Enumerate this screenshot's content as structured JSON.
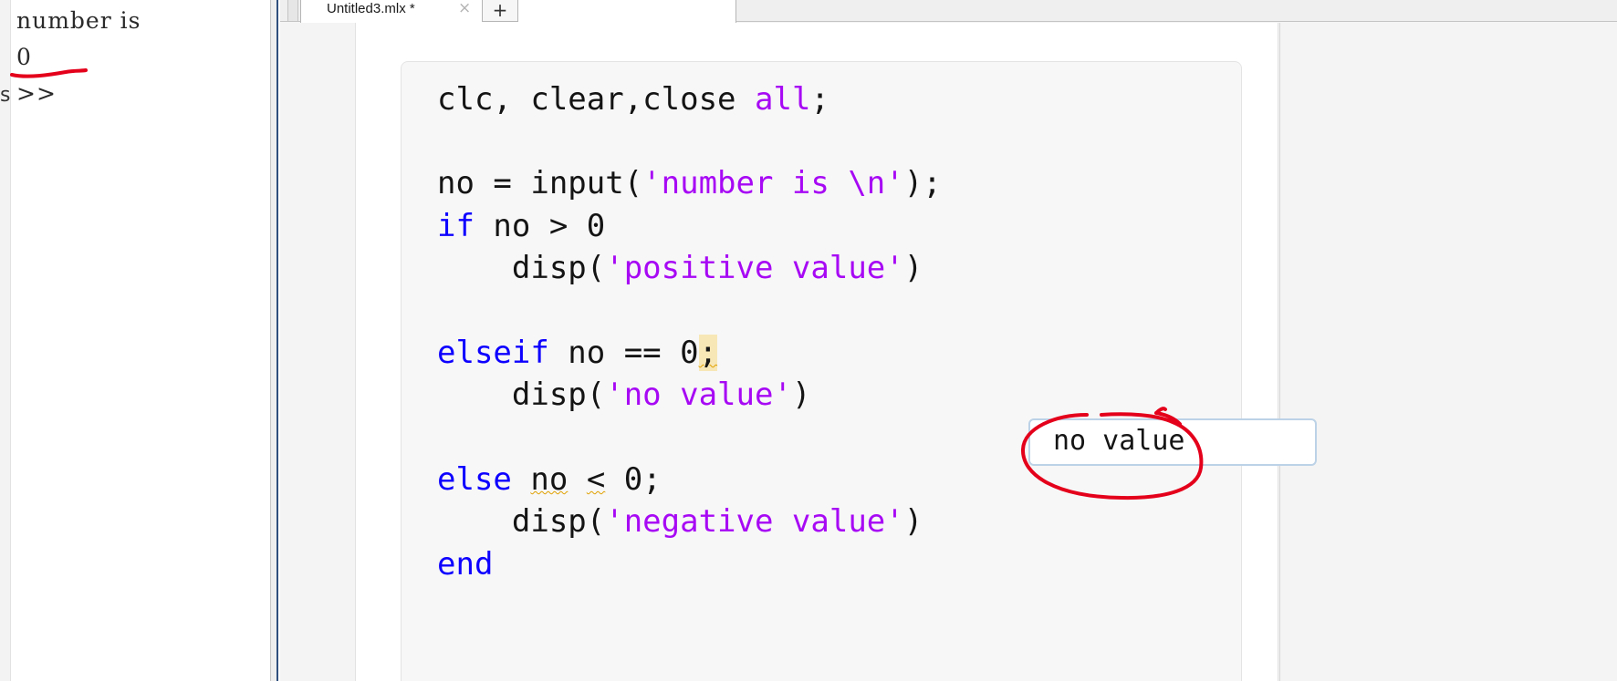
{
  "command_window": {
    "lines": [
      "number is",
      "0",
      ">>"
    ],
    "prompt_marker": "s"
  },
  "editor": {
    "tab": {
      "title": "Untitled3.mlx *",
      "close_glyph": "×",
      "new_tab_glyph": "+"
    },
    "code_lines": [
      {
        "tokens": [
          {
            "t": "clc, clear,close ",
            "c": "plain"
          },
          {
            "t": "all",
            "c": "str"
          },
          {
            "t": ";",
            "c": "plain"
          }
        ]
      },
      {
        "tokens": []
      },
      {
        "tokens": [
          {
            "t": "no = input(",
            "c": "plain"
          },
          {
            "t": "'number is \\n'",
            "c": "str"
          },
          {
            "t": ");",
            "c": "plain"
          }
        ]
      },
      {
        "tokens": [
          {
            "t": "if",
            "c": "kw"
          },
          {
            "t": " no > 0",
            "c": "plain"
          }
        ]
      },
      {
        "tokens": [
          {
            "t": "    disp(",
            "c": "plain"
          },
          {
            "t": "'positive value'",
            "c": "str"
          },
          {
            "t": ")",
            "c": "plain"
          }
        ]
      },
      {
        "tokens": []
      },
      {
        "tokens": [
          {
            "t": "elseif",
            "c": "kw"
          },
          {
            "t": " no == 0",
            "c": "plain"
          },
          {
            "t": ";",
            "c": "hl"
          }
        ]
      },
      {
        "tokens": [
          {
            "t": "    disp(",
            "c": "plain"
          },
          {
            "t": "'no value'",
            "c": "str"
          },
          {
            "t": ")",
            "c": "plain"
          }
        ]
      },
      {
        "tokens": []
      },
      {
        "tokens": [
          {
            "t": "else",
            "c": "kw"
          },
          {
            "t": " ",
            "c": "plain"
          },
          {
            "t": "no",
            "c": "squig"
          },
          {
            "t": " ",
            "c": "plain"
          },
          {
            "t": "<",
            "c": "squig"
          },
          {
            "t": " 0;",
            "c": "plain"
          }
        ]
      },
      {
        "tokens": [
          {
            "t": "    disp(",
            "c": "plain"
          },
          {
            "t": "'negative value'",
            "c": "str"
          },
          {
            "t": ")",
            "c": "plain"
          }
        ]
      },
      {
        "tokens": [
          {
            "t": "end",
            "c": "kw"
          }
        ]
      }
    ]
  },
  "output": {
    "text": "no value"
  },
  "colors": {
    "keyword": "#0e00ff",
    "string": "#a709f5",
    "annotation_red": "#e4001b",
    "highlight": "#f7e6b6"
  }
}
